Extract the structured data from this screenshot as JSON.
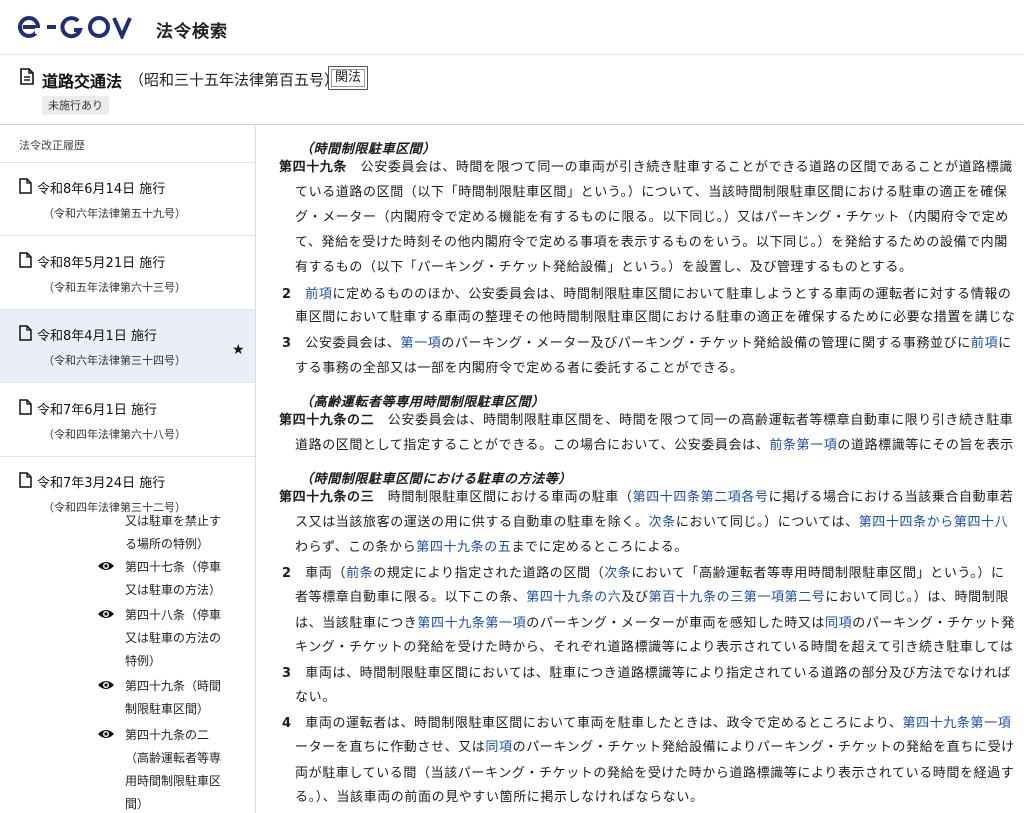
{
  "header": {
    "logo_text": "e-GOV",
    "site_name": "法令検索"
  },
  "law": {
    "title": "道路交通法",
    "number": "（昭和三十五年法律第百五号）",
    "related_button": "関法",
    "status_badge": "未施行あり"
  },
  "left_panel": {
    "heading": "法令改正履歴",
    "revisions": [
      {
        "date": "令和8年6月14日 施行",
        "law": "（令和六年法律第五十九号）"
      },
      {
        "date": "令和8年5月21日 施行",
        "law": "（令和五年法律第六十三号）"
      },
      {
        "date": "令和8年4月1日 施行",
        "law": "（令和六年法律第三十四号）",
        "selected": true
      },
      {
        "date": "令和7年6月1日 施行",
        "law": "（令和四年法律第六十八号）"
      },
      {
        "date": "令和7年3月24日 施行",
        "law": "（令和四年法律第三十二号）"
      }
    ],
    "toc_fragment": [
      "又は駐車を禁止す",
      "る場所の特例）"
    ],
    "toc": [
      [
        "第四十七条（停車",
        "又は駐車の方法）"
      ],
      [
        "第四十八条（停車",
        "又は駐車の方法の",
        "特例）"
      ],
      [
        "第四十九条（時間",
        "制限駐車区間）"
      ],
      [
        "第四十九条の二",
        "（高齢運転者等専",
        "用時間制限駐車区",
        "間）"
      ]
    ]
  },
  "content": {
    "lines": [
      [
        {
          "t": "（時間制限駐車区間）",
          "s": "caption"
        }
      ],
      [
        {
          "t": "第四十九条",
          "s": "artnum"
        },
        {
          "t": "　公安委員会は、時間を限つて同一の車両が引き続き駐車することができる道路の区間であることが道路標識"
        }
      ],
      [
        {
          "t": "ている道路の区間（以下「時間制限駐車区間」という。）について、当該時間制限駐車区間における駐車の適正を確保"
        }
      ],
      [
        {
          "t": "グ・メーター（内閣府令で定める機能を有するものに限る。以下同じ。）又はパーキング・チケット（内閣府令で定め"
        }
      ],
      [
        {
          "t": "て、発給を受けた時刻その他内閣府令で定める事項を表示するものをいう。以下同じ。）を発給するための設備で内閣"
        }
      ],
      [
        {
          "t": "有するもの（以下「パーキング・チケット発給設備」という。）を設置し、及び管理するものとする。"
        }
      ],
      [
        {
          "t": "2",
          "s": "artnum"
        },
        {
          "t": "　"
        },
        {
          "t": "前項",
          "s": "link"
        },
        {
          "t": "に定めるもののほか、公安委員会は、時間制限駐車区間において駐車しようとする車両の運転者に対する情報の"
        }
      ],
      [
        {
          "t": "車区間において駐車する車両の整理その他時間制限駐車区間における駐車の適正を確保するために必要な措置を講じな"
        }
      ],
      [
        {
          "t": "3",
          "s": "artnum"
        },
        {
          "t": "　公安委員会は、"
        },
        {
          "t": "第一項",
          "s": "link"
        },
        {
          "t": "のパーキング・メーター及びパーキング・チケット発給設備の管理に関する事務並びに"
        },
        {
          "t": "前項",
          "s": "link"
        },
        {
          "t": "に"
        }
      ],
      [
        {
          "t": "する事務の全部又は一部を内閣府令で定める者に委託することができる。"
        }
      ],
      [
        {
          "t": "（高齢運転者等専用時間制限駐車区間）",
          "s": "caption"
        }
      ],
      [
        {
          "t": "第四十九条の二",
          "s": "artnum"
        },
        {
          "t": "　公安委員会は、時間制限駐車区間を、時間を限つて同一の高齢運転者等標章自動車に限り引き続き駐車"
        }
      ],
      [
        {
          "t": "道路の区間として指定することができる。この場合において、公安委員会は、"
        },
        {
          "t": "前条第一項",
          "s": "link"
        },
        {
          "t": "の道路標識等にその旨を表示"
        }
      ],
      [
        {
          "t": "（時間制限駐車区間における駐車の方法等）",
          "s": "caption"
        }
      ],
      [
        {
          "t": "第四十九条の三",
          "s": "artnum"
        },
        {
          "t": "　時間制限駐車区間における車両の駐車（"
        },
        {
          "t": "第四十四条第二項各号",
          "s": "link"
        },
        {
          "t": "に掲げる場合における当該乗合自動車若"
        }
      ],
      [
        {
          "t": "ス又は当該旅客の運送の用に供する自動車の駐車を除く。"
        },
        {
          "t": "次条",
          "s": "link"
        },
        {
          "t": "において同じ。）については、"
        },
        {
          "t": "第四十四条から第四十八",
          "s": "link"
        }
      ],
      [
        {
          "t": "わらず、この条から"
        },
        {
          "t": "第四十九条の五",
          "s": "link"
        },
        {
          "t": "までに定めるところによる。"
        }
      ],
      [
        {
          "t": "2",
          "s": "artnum"
        },
        {
          "t": "　車両（"
        },
        {
          "t": "前条",
          "s": "link"
        },
        {
          "t": "の規定により指定された道路の区間（"
        },
        {
          "t": "次条",
          "s": "link"
        },
        {
          "t": "において「高齢運転者等専用時間制限駐車区間」という。）に"
        }
      ],
      [
        {
          "t": "者等標章自動車に限る。以下この条、"
        },
        {
          "t": "第四十九条の六",
          "s": "link"
        },
        {
          "t": "及び"
        },
        {
          "t": "第百十九条の三第一項第二号",
          "s": "link"
        },
        {
          "t": "において同じ。）は、時間制限"
        }
      ],
      [
        {
          "t": "は、当該駐車につき"
        },
        {
          "t": "第四十九条第一項",
          "s": "link"
        },
        {
          "t": "のパーキング・メーターが車両を感知した時又は"
        },
        {
          "t": "同項",
          "s": "link"
        },
        {
          "t": "のパーキング・チケット発"
        }
      ],
      [
        {
          "t": "キング・チケットの発給を受けた時から、それぞれ道路標識等により表示されている時間を超えて引き続き駐車しては"
        }
      ],
      [
        {
          "t": "3",
          "s": "artnum"
        },
        {
          "t": "　車両は、時間制限駐車区間においては、駐車につき道路標識等により指定されている道路の部分及び方法でなければ"
        }
      ],
      [
        {
          "t": "ない。"
        }
      ],
      [
        {
          "t": "4",
          "s": "artnum"
        },
        {
          "t": "　車両の運転者は、時間制限駐車区間において車両を駐車したときは、政令で定めるところにより、"
        },
        {
          "t": "第四十九条第一項",
          "s": "link"
        }
      ],
      [
        {
          "t": "ーターを直ちに作動させ、又は"
        },
        {
          "t": "同項",
          "s": "link"
        },
        {
          "t": "のパーキング・チケット発給設備によりパーキング・チケットの発給を直ちに受け"
        }
      ],
      [
        {
          "t": "両が駐車している間（当該パーキング・チケットの発給を受けた時から道路標識等により表示されている時間を経過す"
        }
      ],
      [
        {
          "t": "る。）、当該車両の前面の見やすい箇所に掲示しなければならない。"
        }
      ]
    ]
  }
}
